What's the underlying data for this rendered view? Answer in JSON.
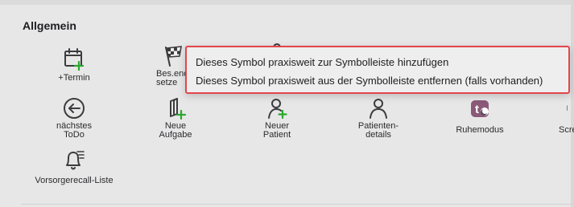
{
  "section": {
    "title": "Allgemein"
  },
  "items": [
    {
      "label": "+Termin",
      "icon": "calendar-add-icon"
    },
    {
      "label": "Bes.ende setze",
      "icon": "checkered-flag-icon"
    },
    {
      "label": "",
      "icon": "partial-icon"
    },
    {
      "label": "nächstes ToDo",
      "icon": "arrow-left-circle-icon"
    },
    {
      "label": "Neue Aufgabe",
      "icon": "new-task-icon"
    },
    {
      "label": "Neuer Patient",
      "icon": "new-patient-icon"
    },
    {
      "label": "Patienten-details",
      "icon": "patient-details-icon"
    },
    {
      "label": "Ruhemodus",
      "icon": "rest-mode-icon"
    },
    {
      "label": "Scre",
      "icon": "screen-icon"
    },
    {
      "label": "Vorsorgerecall-Liste",
      "icon": "recall-list-icon"
    }
  ],
  "context_menu": {
    "add": "Dieses Symbol praxisweit zur Symbolleiste hinzufügen",
    "remove": "Dieses Symbol praxisweit aus der Symbolleiste entfernen (falls vorhanden)"
  }
}
